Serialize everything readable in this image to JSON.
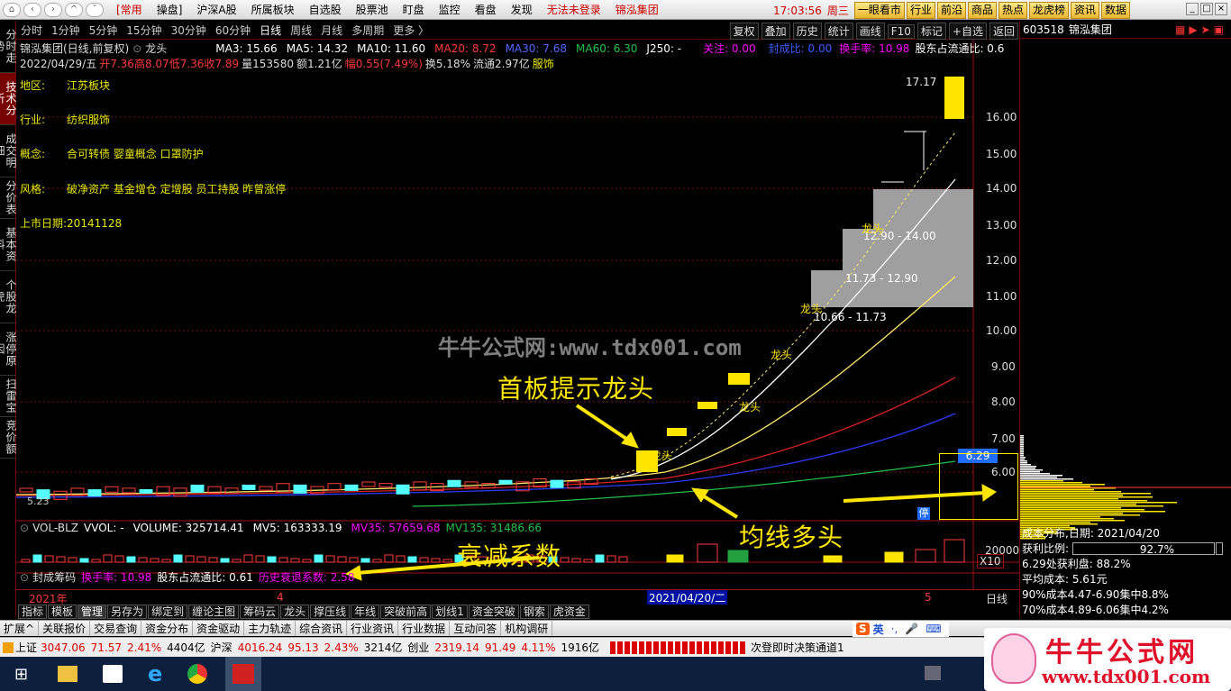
{
  "topbar": {
    "tab_common": "[常用",
    "menus": [
      "操盘]",
      "沪深A股",
      "所属板块",
      "自选股",
      "股票池",
      "盯盘",
      "监控",
      "看盘",
      "发现"
    ],
    "login_status": "无法未登录",
    "stock_name": "锦泓集团",
    "time": "17:03:56",
    "weekday": "周三",
    "quick_buttons": [
      "一眼看市",
      "行业",
      "前沿",
      "商品",
      "热点",
      "龙虎榜",
      "资讯",
      "数据"
    ]
  },
  "periodbar": {
    "periods": [
      "分时",
      "1分钟",
      "5分钟",
      "15分钟",
      "30分钟",
      "60分钟",
      "日线",
      "周线",
      "月线",
      "多周期",
      "更多 〉"
    ],
    "selected": "日线",
    "right_buttons": [
      "复权",
      "叠加",
      "历史",
      "统计",
      "画线",
      "F10",
      "标记",
      "+自选",
      "返回"
    ]
  },
  "left_tabs": [
    "分时走势",
    "技术分析",
    "成交明细",
    "分价表",
    "基本资料",
    "个股龙虎",
    "涨停原因",
    "扫雷宝",
    "竞价额"
  ],
  "left_tab_active": "技术分析",
  "header": {
    "title": "锦泓集团(日线,前复权)",
    "formula": "龙头",
    "ma3": "MA3: 15.66",
    "ma5": "MA5: 14.32",
    "ma10": "MA10: 11.60",
    "ma20": "MA20: 8.72",
    "ma30": "MA30: 7.68",
    "ma60": "MA60: 6.30",
    "j250": "J250: -",
    "guanzhu": "关注: 0.00",
    "fengcheng": "封成比: 0.00",
    "huanshou": "换手率: 10.98",
    "gudong": "股东占流通比: 0.6",
    "date_line": "2022/04/29/五",
    "open": "开7.36",
    "high": "高8.07",
    "low": "低7.36",
    "close": "收7.89",
    "vol": "量153580",
    "amount": "额1.21亿",
    "change": "幅0.55(7.49%)",
    "turnover": "换5.18%",
    "float": "流通2.97亿",
    "clothing": "服饰"
  },
  "f10": [
    {
      "key": "地区:",
      "val": "江苏板块"
    },
    {
      "key": "行业:",
      "val": "纺织服饰"
    },
    {
      "key": "概念:",
      "val": "合可转债 婴童概念 口罩防护"
    },
    {
      "key": "风格:",
      "val": "破净资产 基金增仓 定增股 员工持股 昨曾涨停"
    },
    {
      "key": "上市日期:",
      "val": "20141128"
    }
  ],
  "chart": {
    "y_ticks": [
      "16.00",
      "15.00",
      "14.00",
      "13.00",
      "12.00",
      "11.00",
      "10.00",
      "9.00",
      "8.00",
      "7.00",
      "6.00"
    ],
    "price_tag": "6.29",
    "peak_label": "17.17",
    "low_label": "5.23",
    "boxes": [
      {
        "label": "10.66 - 11.73",
        "tag": "龙头"
      },
      {
        "label": "11.73 - 12.90",
        "tag": ""
      },
      {
        "label": "12.90 - 14.00",
        "tag": "龙头"
      }
    ],
    "signal_labels": [
      "龙头",
      "龙头",
      "龙头"
    ],
    "watermark": "牛牛公式网:www.tdx001.com",
    "annotations": {
      "first_board": "首板提示龙头",
      "ma_bull": "均线多头",
      "decay": "衰减系数"
    },
    "zhang_badge": "停"
  },
  "volume_panel": {
    "name": "VOL-BLZ",
    "vvol": "VVOL: -",
    "volume": "VOLUME: 325714.41",
    "mv5": "MV5: 163333.19",
    "mv35": "MV35: 57659.68",
    "mv135": "MV135: 31486.66",
    "y_label": "20000",
    "x10": "X10"
  },
  "chip_panel": {
    "name": "封成筹码",
    "huanshou": "换手率: 10.98",
    "gudong": "股东占流通比: 0.61",
    "decay": "历史衰退系数: 2.58"
  },
  "timeaxis": {
    "year": "2021年",
    "m4": "4",
    "date": "2021/04/20/二",
    "m5": "5",
    "period": "日线"
  },
  "bottom_tabs": [
    "指标",
    "模板",
    "管理",
    "另存为",
    "绑定到",
    "缠论主图",
    "筹码云",
    "龙头",
    "撑压线",
    "年线",
    "突破前高",
    "划线1",
    "资金突破",
    "钢索",
    "虎资金"
  ],
  "bottom_tab_selected": "管理",
  "ext_bar": [
    "扩展^",
    "关联报价",
    "交易查询",
    "资金分布",
    "资金驱动",
    "主力轨迹",
    "综合资讯",
    "行业资讯",
    "行业数据",
    "互动问答",
    "机构调研"
  ],
  "right_panel": {
    "code": "603518",
    "name": "锦泓集团",
    "cost_title": "成本分布,日期: 2021/04/20",
    "profit_label": "获利比例:",
    "profit_value": "92.7%",
    "profit_at": "6.29处获利盘: 88.2%",
    "avg_cost": "平均成本: 5.61元",
    "c90": "90%成本4.47-6.90集中8.8%",
    "c70": "70%成本4.89-6.06集中4.2%"
  },
  "status_bar": {
    "sh_name": "上证",
    "sh_val": "3047.06",
    "sh_chg": "71.57",
    "sh_pct": "2.41%",
    "sh_amt": "4404亿",
    "sz_name": "沪深",
    "sz_val": "4016.24",
    "sz_chg": "95.13",
    "sz_pct": "2.43%",
    "sz_amt": "3214亿",
    "cy_name": "创业",
    "cy_val": "2319.14",
    "cy_chg": "91.49",
    "cy_pct": "4.11%",
    "cy_amt": "1916亿",
    "notice": "次登即时决策通道1"
  },
  "ime_bar": [
    "英",
    "·,"
  ],
  "logo": {
    "title": "牛牛公式网",
    "url": "www.tdx001.com"
  },
  "colors": {
    "up": "#ff3a3a",
    "down": "#54ffff",
    "yellow": "#ffe500",
    "ma20": "#d42020",
    "ma30": "#2b3cff",
    "ma60": "#22c04a"
  }
}
